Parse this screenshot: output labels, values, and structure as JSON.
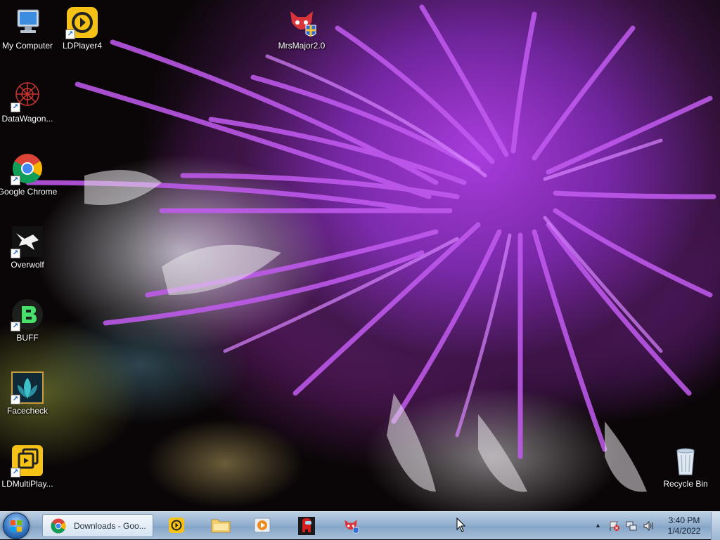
{
  "desktop": {
    "icons": [
      {
        "label": "My Computer"
      },
      {
        "label": "LDPlayer4"
      },
      {
        "label": "MrsMajor2.0"
      },
      {
        "label": "DataWagon..."
      },
      {
        "label": "Google Chrome"
      },
      {
        "label": "Overwolf"
      },
      {
        "label": "BUFF"
      },
      {
        "label": "Facecheck"
      },
      {
        "label": "LDMultiPlay..."
      },
      {
        "label": "Recycle Bin"
      }
    ]
  },
  "taskbar": {
    "active_task": {
      "label": "Downloads - Goo...",
      "icon": "chrome-icon"
    },
    "pinned": [
      {
        "icon": "ldplayer-icon"
      },
      {
        "icon": "folder-icon"
      },
      {
        "icon": "media-player-icon"
      },
      {
        "icon": "among-us-icon"
      },
      {
        "icon": "mrsmajor-icon"
      }
    ],
    "tray": {
      "expand_glyph": "▲",
      "icons": [
        "action-center-flag-icon",
        "network-icon",
        "volume-icon"
      ]
    },
    "clock": {
      "time": "3:40 PM",
      "date": "1/4/2022"
    }
  },
  "colors": {
    "taskbar_top": "#bcd0e4",
    "taskbar_bottom": "#86a5c7",
    "flower_purple": "#a83cdc"
  }
}
